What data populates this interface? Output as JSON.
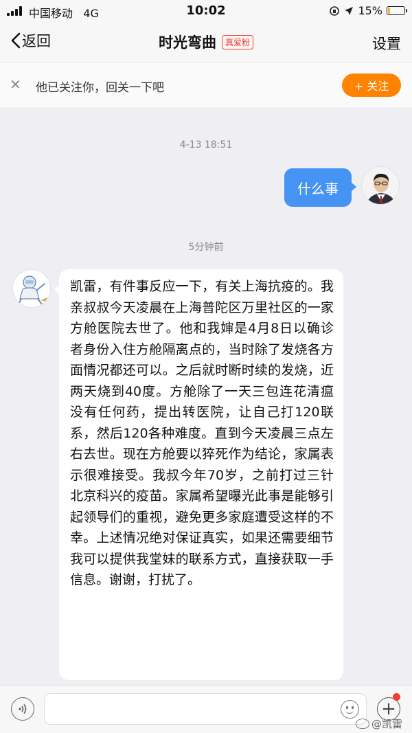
{
  "status_bar": {
    "carrier": "中国移动",
    "network": "4G",
    "time": "10:02",
    "battery": "15%",
    "battery_level": 0.15
  },
  "nav": {
    "back_label": "返回",
    "title": "时光弯曲",
    "badge": "真爱粉",
    "settings_label": "设置"
  },
  "follow_banner": {
    "text": "他已关注你，回关一下吧",
    "button": "+ 关注"
  },
  "messages": [
    {
      "timestamp": "4-13 18:51",
      "sender": "me",
      "text": "什么事"
    },
    {
      "timestamp": "5分钟前",
      "sender": "them",
      "text": "凯雷，有件事反应一下，有关上海抗疫的。我亲叔叔今天凌晨在上海普陀区万里社区的一家方舱医院去世了。他和我婶是4月8日以确诊者身份入住方舱隔离点的，当时除了发烧各方面情况都还可以。之后就时断时续的发烧，近两天烧到40度。方舱除了一天三包连花清瘟没有任何药，提出转医院，让自己打120联系，然后120各种难度。直到今天凌晨三点左右去世。现在方舱要以猝死作为结论，家属表示很难接受。我叔今年70岁，之前打过三针北京科兴的疫苗。家属希望曝光此事是能够引起领导们的重视，避免更多家庭遭受这样的不幸。上述情况绝对保证真实，如果还需要细节我可以提供我堂妹的联系方式，直接获取一手信息。谢谢，打扰了。"
    }
  ],
  "input_bar": {
    "placeholder": ""
  },
  "watermark": "@凯雷",
  "colors": {
    "accent_orange": "#ff8200",
    "bubble_blue": "#4593f2",
    "badge_red": "#e8413a",
    "background": "#efeff3"
  },
  "icons": [
    "back-chevron-icon",
    "close-icon",
    "voice-icon",
    "emoji-icon",
    "plus-icon",
    "weibo-logo-icon"
  ]
}
